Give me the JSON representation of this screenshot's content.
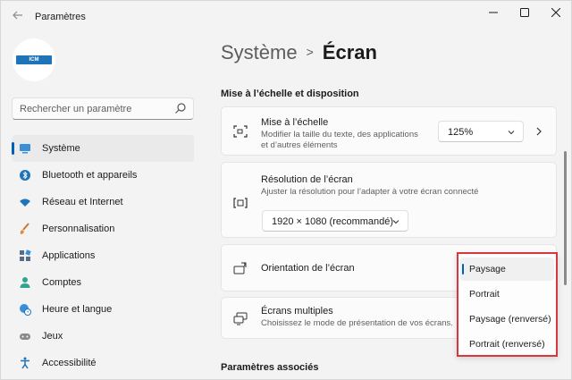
{
  "window": {
    "title": "Paramètres"
  },
  "sidebar": {
    "search_placeholder": "Rechercher un paramètre",
    "logo_text": "ICM",
    "items": [
      {
        "label": "Système",
        "icon": "monitor-icon",
        "active": true
      },
      {
        "label": "Bluetooth et appareils",
        "icon": "bluetooth-icon"
      },
      {
        "label": "Réseau et Internet",
        "icon": "wifi-icon"
      },
      {
        "label": "Personnalisation",
        "icon": "brush-icon"
      },
      {
        "label": "Applications",
        "icon": "apps-icon"
      },
      {
        "label": "Comptes",
        "icon": "person-icon"
      },
      {
        "label": "Heure et langue",
        "icon": "globe-clock-icon"
      },
      {
        "label": "Jeux",
        "icon": "gamepad-icon"
      },
      {
        "label": "Accessibilité",
        "icon": "accessibility-icon"
      }
    ]
  },
  "breadcrumb": {
    "parent": "Système",
    "separator": ">",
    "current": "Écran"
  },
  "main": {
    "section_scale": "Mise à l’échelle et disposition",
    "scale": {
      "title": "Mise à l’échelle",
      "subtitle_1": "Modifier la taille du texte, des applications",
      "subtitle_2": "et d’autres éléments",
      "value": "125%"
    },
    "resolution": {
      "title": "Résolution de l’écran",
      "subtitle": "Ajuster la résolution pour l’adapter à  votre  écran connecté",
      "value": "1920 × 1080 (recommandé)"
    },
    "orientation": {
      "title": "Orientation de l’écran",
      "options": [
        "Paysage",
        "Portrait",
        "Paysage (renversé)",
        "Portrait (renversé)"
      ],
      "selected_index": 0
    },
    "multi": {
      "title": "Écrans multiples",
      "subtitle": "Choisissez le mode de présentation de vos écrans."
    },
    "section_related": "Paramètres associés"
  },
  "colors": {
    "accent": "#005fb8",
    "highlight_border": "#d7373f"
  }
}
